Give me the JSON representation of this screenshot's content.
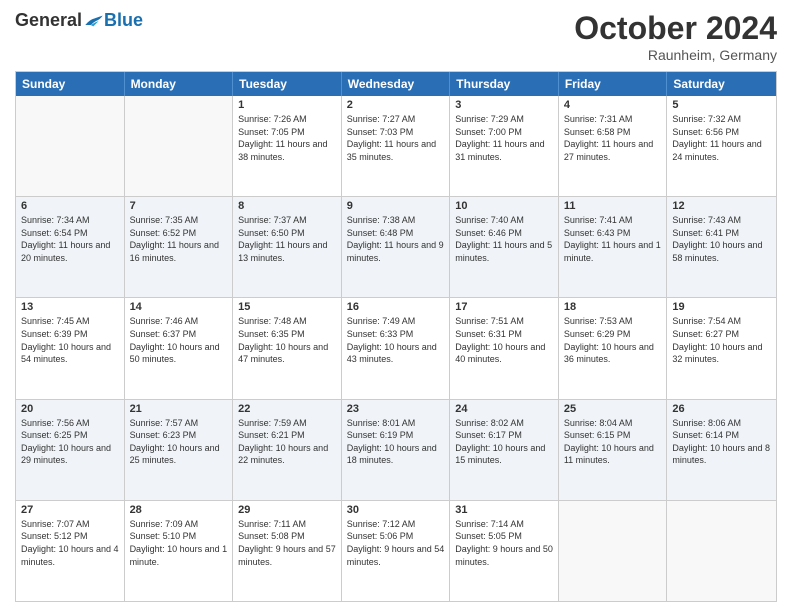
{
  "logo": {
    "general": "General",
    "blue": "Blue"
  },
  "header": {
    "month": "October 2024",
    "location": "Raunheim, Germany"
  },
  "days_of_week": [
    "Sunday",
    "Monday",
    "Tuesday",
    "Wednesday",
    "Thursday",
    "Friday",
    "Saturday"
  ],
  "weeks": [
    {
      "alt": false,
      "cells": [
        {
          "day": "",
          "empty": true
        },
        {
          "day": "",
          "empty": true
        },
        {
          "day": "1",
          "sunrise": "Sunrise: 7:26 AM",
          "sunset": "Sunset: 7:05 PM",
          "daylight": "Daylight: 11 hours and 38 minutes."
        },
        {
          "day": "2",
          "sunrise": "Sunrise: 7:27 AM",
          "sunset": "Sunset: 7:03 PM",
          "daylight": "Daylight: 11 hours and 35 minutes."
        },
        {
          "day": "3",
          "sunrise": "Sunrise: 7:29 AM",
          "sunset": "Sunset: 7:00 PM",
          "daylight": "Daylight: 11 hours and 31 minutes."
        },
        {
          "day": "4",
          "sunrise": "Sunrise: 7:31 AM",
          "sunset": "Sunset: 6:58 PM",
          "daylight": "Daylight: 11 hours and 27 minutes."
        },
        {
          "day": "5",
          "sunrise": "Sunrise: 7:32 AM",
          "sunset": "Sunset: 6:56 PM",
          "daylight": "Daylight: 11 hours and 24 minutes."
        }
      ]
    },
    {
      "alt": true,
      "cells": [
        {
          "day": "6",
          "sunrise": "Sunrise: 7:34 AM",
          "sunset": "Sunset: 6:54 PM",
          "daylight": "Daylight: 11 hours and 20 minutes."
        },
        {
          "day": "7",
          "sunrise": "Sunrise: 7:35 AM",
          "sunset": "Sunset: 6:52 PM",
          "daylight": "Daylight: 11 hours and 16 minutes."
        },
        {
          "day": "8",
          "sunrise": "Sunrise: 7:37 AM",
          "sunset": "Sunset: 6:50 PM",
          "daylight": "Daylight: 11 hours and 13 minutes."
        },
        {
          "day": "9",
          "sunrise": "Sunrise: 7:38 AM",
          "sunset": "Sunset: 6:48 PM",
          "daylight": "Daylight: 11 hours and 9 minutes."
        },
        {
          "day": "10",
          "sunrise": "Sunrise: 7:40 AM",
          "sunset": "Sunset: 6:46 PM",
          "daylight": "Daylight: 11 hours and 5 minutes."
        },
        {
          "day": "11",
          "sunrise": "Sunrise: 7:41 AM",
          "sunset": "Sunset: 6:43 PM",
          "daylight": "Daylight: 11 hours and 1 minute."
        },
        {
          "day": "12",
          "sunrise": "Sunrise: 7:43 AM",
          "sunset": "Sunset: 6:41 PM",
          "daylight": "Daylight: 10 hours and 58 minutes."
        }
      ]
    },
    {
      "alt": false,
      "cells": [
        {
          "day": "13",
          "sunrise": "Sunrise: 7:45 AM",
          "sunset": "Sunset: 6:39 PM",
          "daylight": "Daylight: 10 hours and 54 minutes."
        },
        {
          "day": "14",
          "sunrise": "Sunrise: 7:46 AM",
          "sunset": "Sunset: 6:37 PM",
          "daylight": "Daylight: 10 hours and 50 minutes."
        },
        {
          "day": "15",
          "sunrise": "Sunrise: 7:48 AM",
          "sunset": "Sunset: 6:35 PM",
          "daylight": "Daylight: 10 hours and 47 minutes."
        },
        {
          "day": "16",
          "sunrise": "Sunrise: 7:49 AM",
          "sunset": "Sunset: 6:33 PM",
          "daylight": "Daylight: 10 hours and 43 minutes."
        },
        {
          "day": "17",
          "sunrise": "Sunrise: 7:51 AM",
          "sunset": "Sunset: 6:31 PM",
          "daylight": "Daylight: 10 hours and 40 minutes."
        },
        {
          "day": "18",
          "sunrise": "Sunrise: 7:53 AM",
          "sunset": "Sunset: 6:29 PM",
          "daylight": "Daylight: 10 hours and 36 minutes."
        },
        {
          "day": "19",
          "sunrise": "Sunrise: 7:54 AM",
          "sunset": "Sunset: 6:27 PM",
          "daylight": "Daylight: 10 hours and 32 minutes."
        }
      ]
    },
    {
      "alt": true,
      "cells": [
        {
          "day": "20",
          "sunrise": "Sunrise: 7:56 AM",
          "sunset": "Sunset: 6:25 PM",
          "daylight": "Daylight: 10 hours and 29 minutes."
        },
        {
          "day": "21",
          "sunrise": "Sunrise: 7:57 AM",
          "sunset": "Sunset: 6:23 PM",
          "daylight": "Daylight: 10 hours and 25 minutes."
        },
        {
          "day": "22",
          "sunrise": "Sunrise: 7:59 AM",
          "sunset": "Sunset: 6:21 PM",
          "daylight": "Daylight: 10 hours and 22 minutes."
        },
        {
          "day": "23",
          "sunrise": "Sunrise: 8:01 AM",
          "sunset": "Sunset: 6:19 PM",
          "daylight": "Daylight: 10 hours and 18 minutes."
        },
        {
          "day": "24",
          "sunrise": "Sunrise: 8:02 AM",
          "sunset": "Sunset: 6:17 PM",
          "daylight": "Daylight: 10 hours and 15 minutes."
        },
        {
          "day": "25",
          "sunrise": "Sunrise: 8:04 AM",
          "sunset": "Sunset: 6:15 PM",
          "daylight": "Daylight: 10 hours and 11 minutes."
        },
        {
          "day": "26",
          "sunrise": "Sunrise: 8:06 AM",
          "sunset": "Sunset: 6:14 PM",
          "daylight": "Daylight: 10 hours and 8 minutes."
        }
      ]
    },
    {
      "alt": false,
      "cells": [
        {
          "day": "27",
          "sunrise": "Sunrise: 7:07 AM",
          "sunset": "Sunset: 5:12 PM",
          "daylight": "Daylight: 10 hours and 4 minutes."
        },
        {
          "day": "28",
          "sunrise": "Sunrise: 7:09 AM",
          "sunset": "Sunset: 5:10 PM",
          "daylight": "Daylight: 10 hours and 1 minute."
        },
        {
          "day": "29",
          "sunrise": "Sunrise: 7:11 AM",
          "sunset": "Sunset: 5:08 PM",
          "daylight": "Daylight: 9 hours and 57 minutes."
        },
        {
          "day": "30",
          "sunrise": "Sunrise: 7:12 AM",
          "sunset": "Sunset: 5:06 PM",
          "daylight": "Daylight: 9 hours and 54 minutes."
        },
        {
          "day": "31",
          "sunrise": "Sunrise: 7:14 AM",
          "sunset": "Sunset: 5:05 PM",
          "daylight": "Daylight: 9 hours and 50 minutes."
        },
        {
          "day": "",
          "empty": true
        },
        {
          "day": "",
          "empty": true
        }
      ]
    }
  ]
}
